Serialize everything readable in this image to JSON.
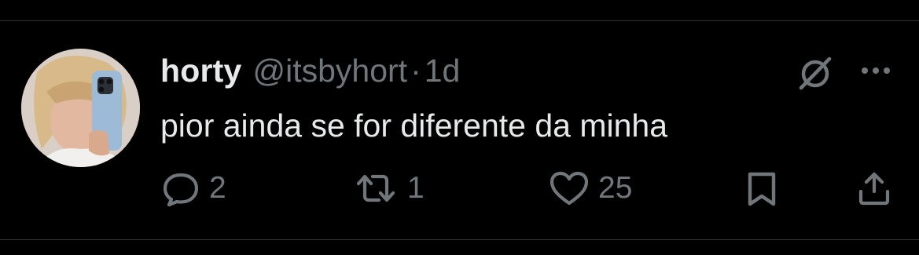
{
  "tweet": {
    "author": {
      "display_name": "horty",
      "handle": "@itsbyhort",
      "avatar_icon": "profile-photo"
    },
    "separator": "·",
    "timestamp": "1d",
    "text": "pior ainda se for diferente da minha"
  },
  "header_icons": {
    "grok": "grok-icon",
    "more": "more-icon"
  },
  "actions": {
    "reply": {
      "icon": "reply-icon",
      "count": "2"
    },
    "retweet": {
      "icon": "retweet-icon",
      "count": "1"
    },
    "like": {
      "icon": "heart-icon",
      "count": "25"
    },
    "bookmark": {
      "icon": "bookmark-icon"
    },
    "share": {
      "icon": "share-icon"
    }
  },
  "colors": {
    "background": "#000000",
    "primary_text": "#e7e9ea",
    "secondary_text": "#71767b",
    "divider": "#2f3336"
  }
}
